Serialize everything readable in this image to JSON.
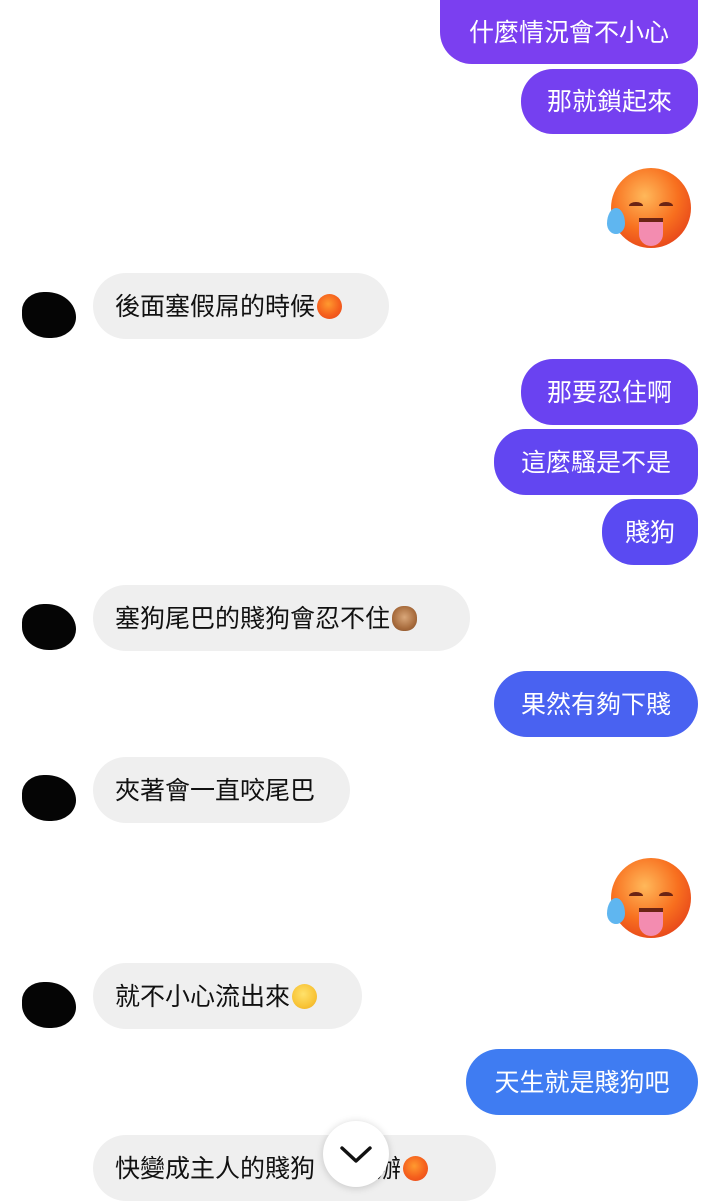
{
  "messages": [
    {
      "type": "outgoing",
      "text": "什麼情況會不小心",
      "color": "#7b3ff0"
    },
    {
      "type": "outgoing",
      "text": "那就鎖起來",
      "color": "#7540f0"
    },
    {
      "type": "outgoing_emoji",
      "emoji": "hot-face-drooling"
    },
    {
      "type": "incoming",
      "text": "後面塞假屌的時候",
      "emoji": "hot-face"
    },
    {
      "type": "outgoing",
      "text": "那要忍住啊",
      "color": "#6a42f1"
    },
    {
      "type": "outgoing",
      "text": "這麼騷是不是",
      "color": "#6246f1"
    },
    {
      "type": "outgoing",
      "text": "賤狗",
      "color": "#5a4af2"
    },
    {
      "type": "incoming",
      "text": "塞狗尾巴的賤狗會忍不住",
      "emoji": "see-no-evil-monkey"
    },
    {
      "type": "outgoing",
      "text": "果然有夠下賤",
      "color": "#4962f1"
    },
    {
      "type": "incoming",
      "text": "夾著會一直咬尾巴"
    },
    {
      "type": "outgoing_emoji",
      "emoji": "hot-face-drooling"
    },
    {
      "type": "incoming",
      "text": "就不小心流出來",
      "emoji": "crying-face"
    },
    {
      "type": "outgoing",
      "text": "天生就是賤狗吧",
      "color": "#3f7cf2"
    },
    {
      "type": "incoming",
      "text": "快變成主人的賤狗",
      "hidden_part": "麼辦",
      "emoji": "hot-face"
    }
  ],
  "scroll_button": {
    "icon": "chevron-down-icon"
  }
}
